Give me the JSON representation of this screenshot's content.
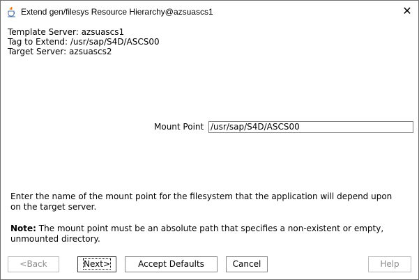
{
  "window": {
    "title": "Extend gen/filesys Resource Hierarchy@azsuascs1",
    "close_symbol": "✕"
  },
  "info": {
    "template_server": "Template Server: azsuascs1",
    "tag_to_extend": "Tag to Extend: /usr/sap/S4D/ASCS00",
    "target_server": "Target Server: azsuascs2"
  },
  "mount_point": {
    "label": "Mount Point",
    "value": "/usr/sap/S4D/ASCS00"
  },
  "description": "Enter the name of the mount point for the filesystem that the application will depend upon on the target server.",
  "note": {
    "label": "Note:",
    "text": " The mount point must be an absolute path that specifies a non-existent or empty, unmounted directory."
  },
  "buttons": {
    "back": "<Back",
    "next": "Next>",
    "accept_defaults": "Accept Defaults",
    "cancel": "Cancel",
    "help": "Help"
  },
  "icons": {
    "app_icon": "java-cup-icon",
    "close_icon": "close-icon"
  }
}
